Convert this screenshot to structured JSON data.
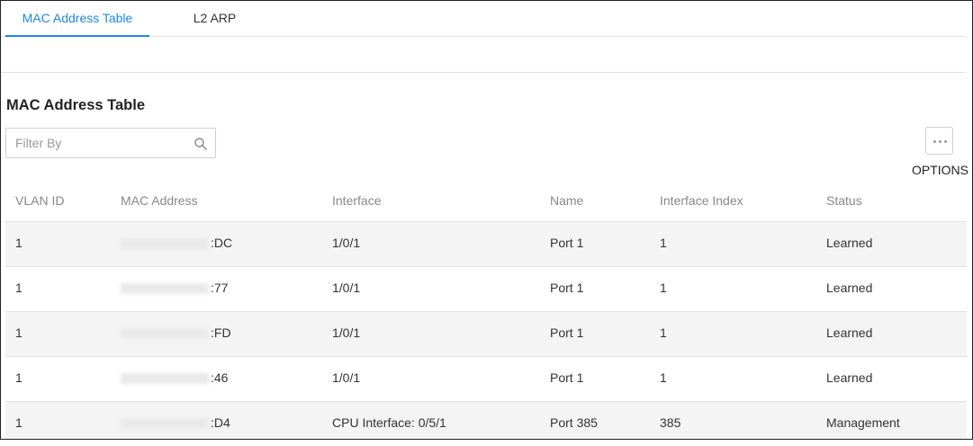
{
  "tabs": [
    {
      "label": "MAC Address Table",
      "active": true
    },
    {
      "label": "L2 ARP",
      "active": false
    }
  ],
  "section_title": "MAC Address Table",
  "filter": {
    "placeholder": "Filter By"
  },
  "options": {
    "label": "OPTIONS"
  },
  "table": {
    "columns": [
      "VLAN ID",
      "MAC Address",
      "Interface",
      "Name",
      "Interface Index",
      "Status"
    ],
    "rows": [
      {
        "vlan": "1",
        "mac_suffix": ":DC",
        "interface": "1/0/1",
        "name": "Port 1",
        "index": "1",
        "status": "Learned"
      },
      {
        "vlan": "1",
        "mac_suffix": ":77",
        "interface": "1/0/1",
        "name": "Port 1",
        "index": "1",
        "status": "Learned"
      },
      {
        "vlan": "1",
        "mac_suffix": ":FD",
        "interface": "1/0/1",
        "name": "Port 1",
        "index": "1",
        "status": "Learned"
      },
      {
        "vlan": "1",
        "mac_suffix": ":46",
        "interface": "1/0/1",
        "name": "Port 1",
        "index": "1",
        "status": "Learned"
      },
      {
        "vlan": "1",
        "mac_suffix": ":D4",
        "interface": "CPU Interface: 0/5/1",
        "name": "Port 385",
        "index": "385",
        "status": "Management"
      }
    ]
  },
  "colors": {
    "accent": "#1e88e5",
    "row_shade": "#f4f4f4",
    "border": "#e2e2e2"
  },
  "icons": [
    "search-icon",
    "more-options-icon"
  ]
}
